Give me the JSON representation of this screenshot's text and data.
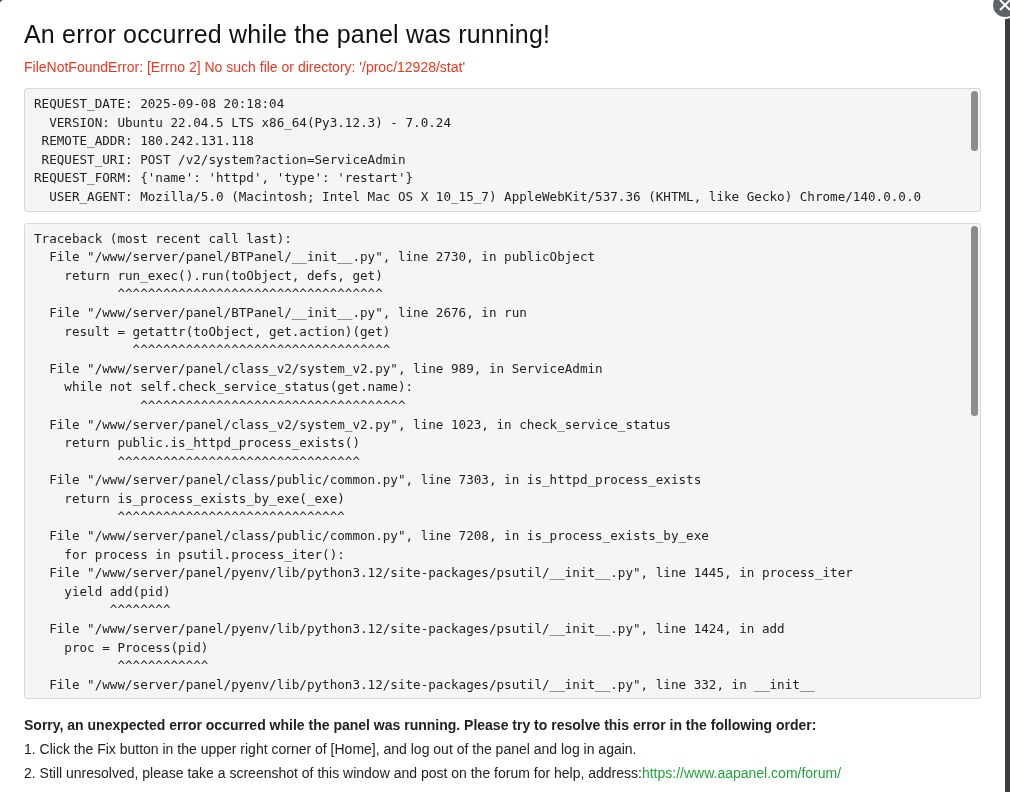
{
  "dialog": {
    "title": "An error occurred while the panel was running!",
    "error_message": "FileNotFoundError: [Errno 2] No such file or directory: '/proc/12928/stat'",
    "request_info": [
      "REQUEST_DATE: 2025-09-08 20:18:04",
      "  VERSION: Ubuntu 22.04.5 LTS x86_64(Py3.12.3) - 7.0.24",
      " REMOTE_ADDR: 180.242.131.118",
      " REQUEST_URI: POST /v2/system?action=ServiceAdmin",
      "REQUEST_FORM: {'name': 'httpd', 'type': 'restart'}",
      "  USER_AGENT: Mozilla/5.0 (Macintosh; Intel Mac OS X 10_15_7) AppleWebKit/537.36 (KHTML, like Gecko) Chrome/140.0.0.0"
    ],
    "traceback": [
      "Traceback (most recent call last):",
      "  File \"/www/server/panel/BTPanel/__init__.py\", line 2730, in publicObject",
      "    return run_exec().run(toObject, defs, get)",
      "           ^^^^^^^^^^^^^^^^^^^^^^^^^^^^^^^^^^^",
      "  File \"/www/server/panel/BTPanel/__init__.py\", line 2676, in run",
      "    result = getattr(toObject, get.action)(get)",
      "             ^^^^^^^^^^^^^^^^^^^^^^^^^^^^^^^^^^",
      "  File \"/www/server/panel/class_v2/system_v2.py\", line 989, in ServiceAdmin",
      "    while not self.check_service_status(get.name):",
      "              ^^^^^^^^^^^^^^^^^^^^^^^^^^^^^^^^^^^",
      "  File \"/www/server/panel/class_v2/system_v2.py\", line 1023, in check_service_status",
      "    return public.is_httpd_process_exists()",
      "           ^^^^^^^^^^^^^^^^^^^^^^^^^^^^^^^^",
      "  File \"/www/server/panel/class/public/common.py\", line 7303, in is_httpd_process_exists",
      "    return is_process_exists_by_exe(_exe)",
      "           ^^^^^^^^^^^^^^^^^^^^^^^^^^^^^^",
      "  File \"/www/server/panel/class/public/common.py\", line 7208, in is_process_exists_by_exe",
      "    for process in psutil.process_iter():",
      "  File \"/www/server/panel/pyenv/lib/python3.12/site-packages/psutil/__init__.py\", line 1445, in process_iter",
      "    yield add(pid)",
      "          ^^^^^^^^",
      "  File \"/www/server/panel/pyenv/lib/python3.12/site-packages/psutil/__init__.py\", line 1424, in add",
      "    proc = Process(pid)",
      "           ^^^^^^^^^^^^",
      "  File \"/www/server/panel/pyenv/lib/python3.12/site-packages/psutil/__init__.py\", line 332, in __init__"
    ],
    "help": {
      "heading": "Sorry, an unexpected error occurred while the panel was running. Please try to resolve this error in the following order:",
      "steps": [
        {
          "text": "1. Click the Fix button in the upper right corner of [Home], and log out of the panel and log in again."
        },
        {
          "text": "2. Still unresolved, please take a screenshot of this window and post on the forum for help, address:",
          "link": "https://www.aapanel.com/forum/"
        }
      ]
    }
  }
}
